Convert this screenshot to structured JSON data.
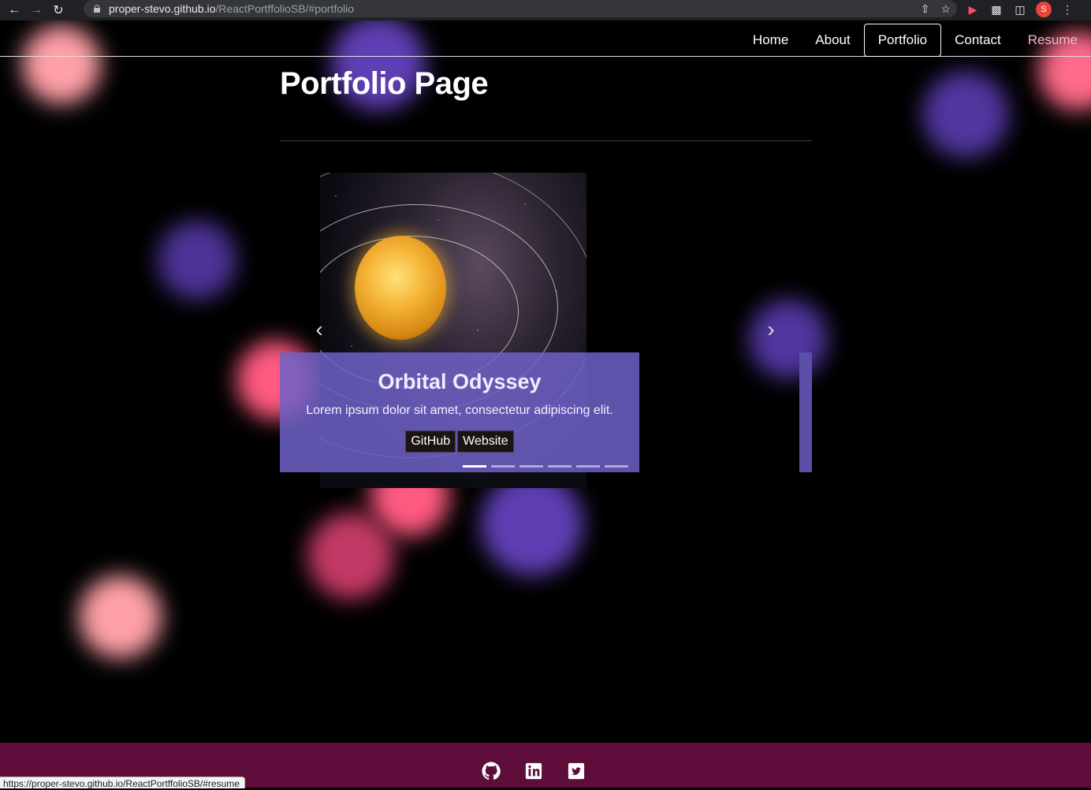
{
  "browser": {
    "url_host": "proper-stevo.github.io",
    "url_path": "/ReactPortffolioSB/#portfolio",
    "avatar_letter": "S",
    "status_url": "https://proper-stevo.github.io/ReactPortffolioSB/#resume"
  },
  "nav": {
    "items": [
      {
        "label": "Home"
      },
      {
        "label": "About"
      },
      {
        "label": "Portfolio",
        "active": true
      },
      {
        "label": "Contact"
      },
      {
        "label": "Resume"
      }
    ]
  },
  "page": {
    "title": "Portfolio Page"
  },
  "carousel": {
    "slide_title": "Orbital Odyssey",
    "slide_text": "Lorem ipsum dolor sit amet, consectetur adipiscing elit.",
    "buttons": [
      "GitHub",
      "Website"
    ],
    "indicator_count": 6,
    "active_indicator": 0,
    "prev_icon": "chevron-left-icon",
    "next_icon": "chevron-right-icon"
  },
  "footer": {
    "icons": [
      "github-icon",
      "linkedin-icon",
      "twitter-icon"
    ]
  },
  "colors": {
    "background": "#000000",
    "footer": "#5e0d3b",
    "caption": "#6e62c8",
    "blob_pink": "#ff6b8a",
    "blob_purple": "#6a46c8"
  }
}
